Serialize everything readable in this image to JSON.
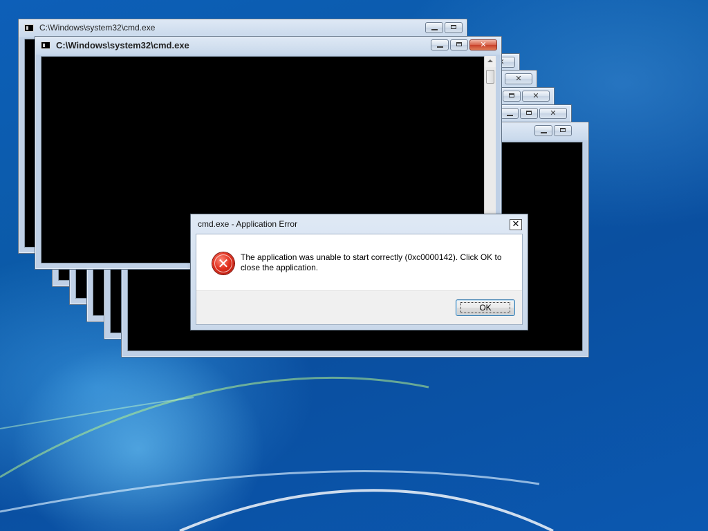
{
  "cmd_windows": {
    "title": "C:\\Windows\\system32\\cmd.exe",
    "icon": "cmd-icon",
    "colors": {
      "console_bg": "#000000",
      "frame": "#bfd0e6",
      "close_active": "#c7402a"
    }
  },
  "error_dialog": {
    "title": "cmd.exe - Application Error",
    "message": "The application was unable to start correctly (0xc0000142). Click OK to close the application.",
    "ok_label": "OK",
    "close_glyph": "✕",
    "icon": "error-icon",
    "icon_glyph": "✕"
  }
}
